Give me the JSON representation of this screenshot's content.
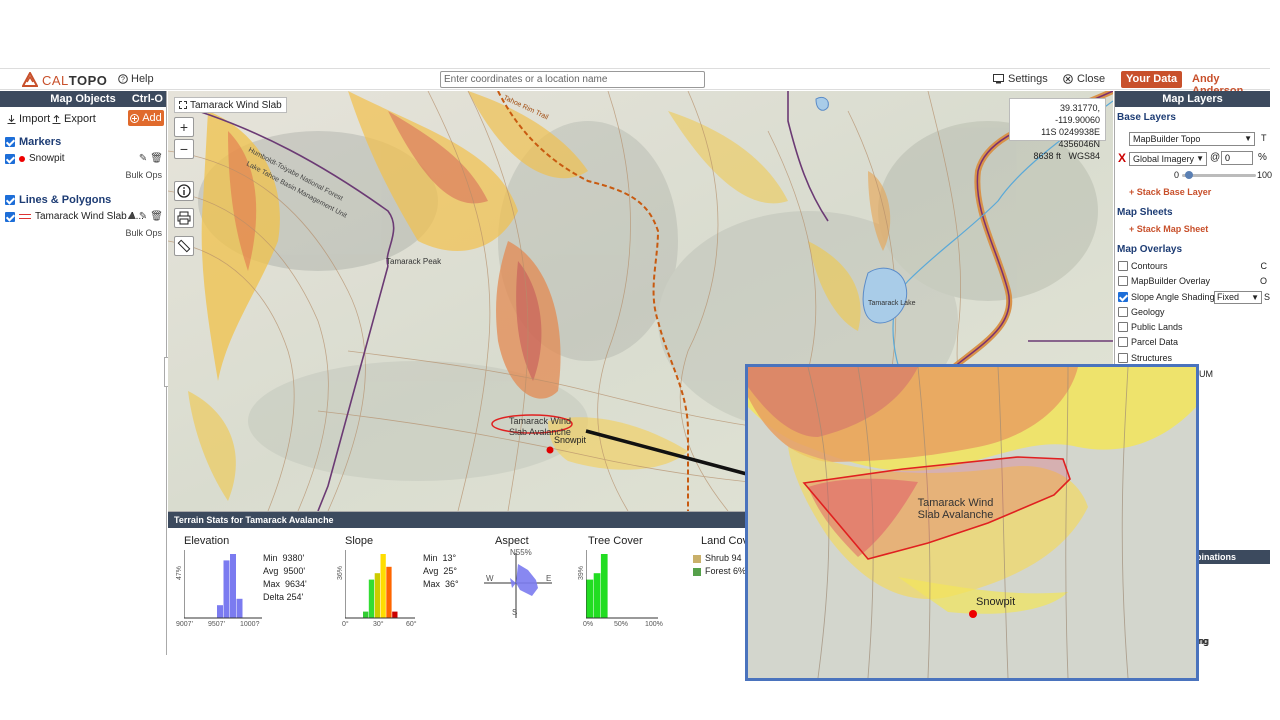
{
  "app": {
    "brand_left": "CAL",
    "brand_right": "TOPO",
    "help_label": "Help",
    "search_placeholder": "Enter coordinates or a location name",
    "settings_label": "Settings",
    "close_label": "Close",
    "your_data_label": "Your Data",
    "user_name": "Andy Anderson"
  },
  "left_panel": {
    "title": "Map Objects",
    "shortcut": "Ctrl-O",
    "import_label": "Import",
    "export_label": "Export",
    "add_label": "Add",
    "markers_title": "Markers",
    "marker_item": "Snowpit",
    "bulk_ops_1": "Bulk Ops",
    "lines_title": "Lines & Polygons",
    "polygon_item": "Tamarack Wind Slab A...",
    "bulk_ops_2": "Bulk Ops"
  },
  "map": {
    "title_chip": "Tamarack Wind Slab",
    "coords_line1": "39.31770, -119.90060",
    "coords_line2": "11S 0249938E 4356046N",
    "coords_alt": "8638 ft",
    "coords_datum": "WGS84",
    "label_tamarack_peak": "Tamarack Peak",
    "label_tamarack_lake": "Tamarack Lake",
    "label_avalanche_line1": "Tamarack Wind",
    "label_avalanche_line2": "Slab Avalanche",
    "label_snowpit": "Snowpit",
    "label_forest_1": "Humboldt-Toiyabe National Forest",
    "label_lake_tahoe_basin": "Lake Tahoe Basin Management Unit",
    "label_trail": "Tahoe Rim Trail"
  },
  "right_panel": {
    "title": "Map Layers",
    "base_layers": "Base Layers",
    "base_select": "MapBuilder Topo",
    "base_key": "T",
    "stack_x": "X",
    "global_select": "Global Imagery",
    "opacity_at": "@",
    "opacity_value": "0",
    "opacity_unit": "%",
    "slider_min": "0",
    "slider_max": "100",
    "stack_base_layer": "+ Stack Base Layer",
    "map_sheets": "Map Sheets",
    "stack_map_sheet": "+ Stack Map Sheet",
    "map_overlays": "Map Overlays",
    "overlays": [
      {
        "label": "Contours",
        "key": "C",
        "checked": false
      },
      {
        "label": "MapBuilder Overlay",
        "key": "O",
        "checked": false
      },
      {
        "label": "Slope Angle Shading",
        "key": "S",
        "checked": true
      },
      {
        "label": "Geology",
        "key": "",
        "checked": false
      },
      {
        "label": "Public Lands",
        "key": "",
        "checked": false
      },
      {
        "label": "Parcel Data",
        "key": "",
        "checked": false
      },
      {
        "label": "Structures",
        "key": "",
        "checked": false
      }
    ],
    "slope_mode": "Fixed",
    "partial_um": "UM",
    "combinations": "binations",
    "partial_ng": "ng"
  },
  "terrain_stats": {
    "header": "Terrain Stats for Tamarack Avalanche",
    "elevation": {
      "title": "Elevation",
      "ylabel": "47%",
      "min_label": "Min",
      "min": "9380'",
      "avg_label": "Avg",
      "avg": "9500'",
      "max_label": "Max",
      "max": "9634'",
      "delta_label": "Delta",
      "delta": "254'",
      "ticks": [
        "9007'",
        "9507'",
        "1000?"
      ],
      "bars": [
        0,
        0,
        0,
        0,
        0,
        2,
        9,
        10,
        3,
        0,
        0,
        0
      ]
    },
    "slope": {
      "title": "Slope",
      "ylabel": "36%",
      "min_label": "Min",
      "min": "13°",
      "avg_label": "Avg",
      "avg": "25°",
      "max_label": "Max",
      "max": "36°",
      "ticks": [
        "0°",
        "30°",
        "60°"
      ],
      "bars": [
        0,
        0,
        0,
        1,
        6,
        7,
        10,
        8,
        1,
        0,
        0,
        0
      ],
      "bar_colors": [
        "#aaaaaa",
        "#aaaaaa",
        "#aaaaaa",
        "#33cc33",
        "#33dd33",
        "#cccc00",
        "#ffdd00",
        "#ff6600",
        "#cc0000",
        "#cc0000",
        "#cc0000",
        "#cc0000"
      ]
    },
    "aspect": {
      "title": "Aspect",
      "north": "N",
      "north_pct": "55%",
      "west": "W",
      "east": "E",
      "south": "S"
    },
    "tree_cover": {
      "title": "Tree Cover",
      "ylabel": "39%",
      "ticks": [
        "0%",
        "50%",
        "100%"
      ],
      "bars": [
        6,
        7,
        10,
        0,
        0,
        0,
        0,
        0,
        0,
        0
      ]
    },
    "land_cover": {
      "title": "Land Cov",
      "items": [
        {
          "label": "Shrub",
          "value": "94",
          "color": "#c9b06a"
        },
        {
          "label": "Forest",
          "value": "6%",
          "color": "#55a04a"
        }
      ]
    }
  },
  "inset": {
    "label_line1": "Tamarack Wind",
    "label_line2": "Slab Avalanche",
    "snowpit": "Snowpit"
  }
}
